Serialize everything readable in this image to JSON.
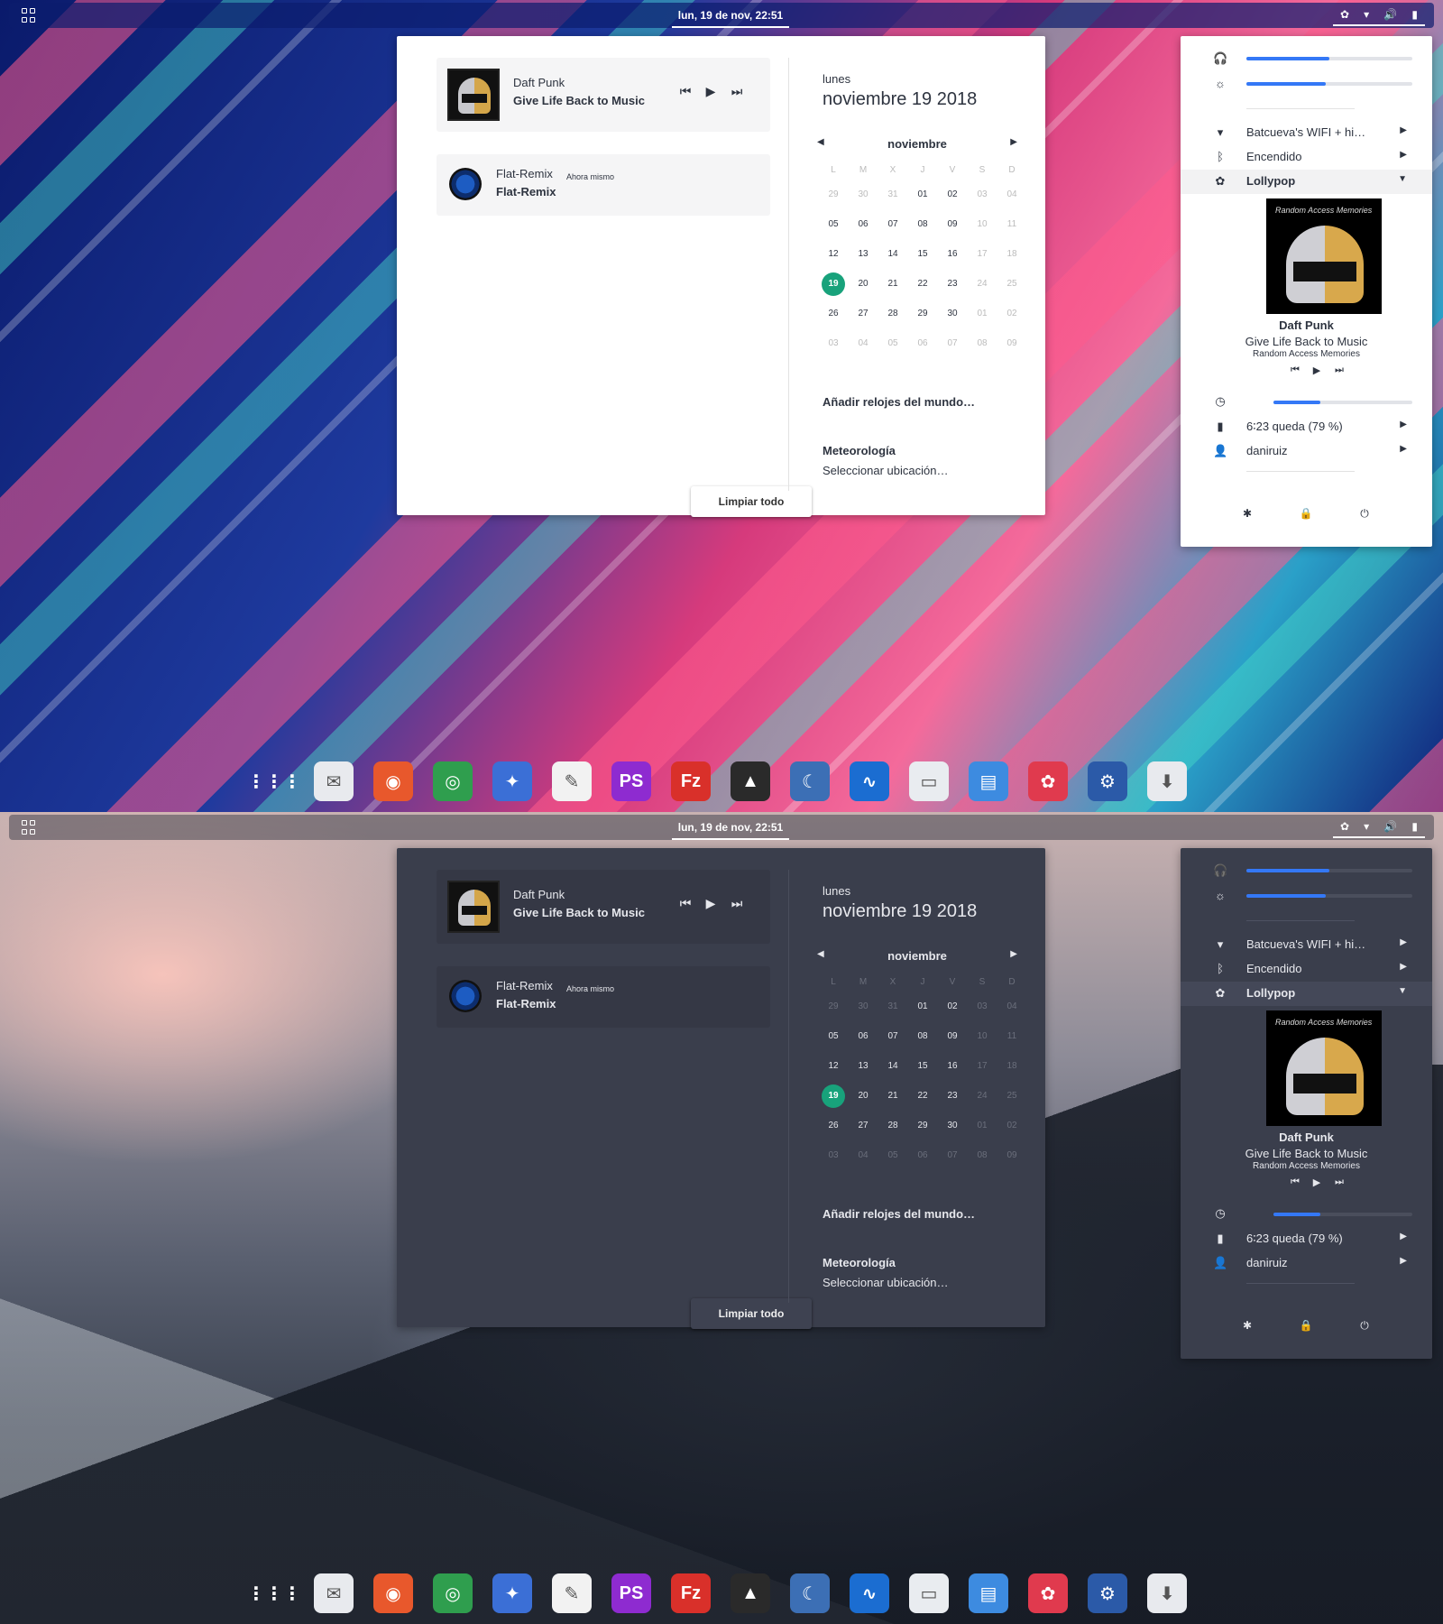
{
  "topbar": {
    "clock": "lun, 19 de nov, 22:51"
  },
  "calendar_panel": {
    "media": {
      "artist": "Daft Punk",
      "title": "Give Life Back to Music",
      "prev_icon": "skip-previous-icon",
      "play_icon": "play-icon",
      "next_icon": "skip-next-icon"
    },
    "app_notification": {
      "app": "Flat-Remix",
      "time": "Ahora mismo",
      "body": "Flat-Remix"
    },
    "clear_button": "Limpiar todo",
    "day_name": "lunes",
    "full_date": "noviembre 19 2018",
    "month": "noviembre",
    "weekdays": [
      "L",
      "M",
      "X",
      "J",
      "V",
      "S",
      "D"
    ],
    "days": [
      [
        "29",
        "30",
        "31",
        "01",
        "02",
        "03",
        "04"
      ],
      [
        "05",
        "06",
        "07",
        "08",
        "09",
        "10",
        "11"
      ],
      [
        "12",
        "13",
        "14",
        "15",
        "16",
        "17",
        "18"
      ],
      [
        "19",
        "20",
        "21",
        "22",
        "23",
        "24",
        "25"
      ],
      [
        "26",
        "27",
        "28",
        "29",
        "30",
        "01",
        "02"
      ],
      [
        "03",
        "04",
        "05",
        "06",
        "07",
        "08",
        "09"
      ]
    ],
    "today": "19",
    "world_clocks": "Añadir relojes del mundo…",
    "weather_title": "Meteorología",
    "weather_location": "Seleccionar ubicación…"
  },
  "system_menu": {
    "volume_level": 0.5,
    "brightness_level": 0.48,
    "wifi": "Batcueva's WIFI + hi…",
    "bluetooth": "Encendido",
    "player_name": "Lollypop",
    "player": {
      "artist": "Daft Punk",
      "title": "Give Life Back to Music",
      "album": "Random Access Memories",
      "cover_text": "Random Access Memories",
      "progress": 0.34
    },
    "battery": "6∶23 queda (79 %)",
    "user": "daniruiz"
  },
  "dock_apps": [
    {
      "name": "app-grid",
      "glyph": "⋮⋮⋮",
      "color": "transparent"
    },
    {
      "name": "mail",
      "glyph": "✉",
      "color": "#e8eaee"
    },
    {
      "name": "firefox",
      "glyph": "◉",
      "color": "#e8582c"
    },
    {
      "name": "chrome",
      "glyph": "◎",
      "color": "#2f9e4e"
    },
    {
      "name": "web-browser",
      "glyph": "✦",
      "color": "#3b6fd6"
    },
    {
      "name": "text-editor",
      "glyph": "✎",
      "color": "#f2f2f2"
    },
    {
      "name": "pycharm",
      "glyph": "PS",
      "color": "#8e2bd0"
    },
    {
      "name": "filezilla",
      "glyph": "Fz",
      "color": "#d9302a"
    },
    {
      "name": "inkscape",
      "glyph": "▲",
      "color": "#2a2a2a"
    },
    {
      "name": "kali-dragon",
      "glyph": "☾",
      "color": "#3c6fb5"
    },
    {
      "name": "system-monitor",
      "glyph": "∿",
      "color": "#1b6dd1"
    },
    {
      "name": "files",
      "glyph": "▭",
      "color": "#e9ecf0"
    },
    {
      "name": "document-viewer",
      "glyph": "▤",
      "color": "#3d8be0"
    },
    {
      "name": "lollypop",
      "glyph": "✿",
      "color": "#e03a4e"
    },
    {
      "name": "steam",
      "glyph": "⚙",
      "color": "#2b5aa8"
    },
    {
      "name": "software",
      "glyph": "⬇",
      "color": "#e8eaee"
    }
  ],
  "colors": {
    "accent_today": "#18a27b",
    "slider_fill": "#3478f6",
    "light_panel": "#ffffff",
    "dark_panel": "#3a3e4c"
  }
}
